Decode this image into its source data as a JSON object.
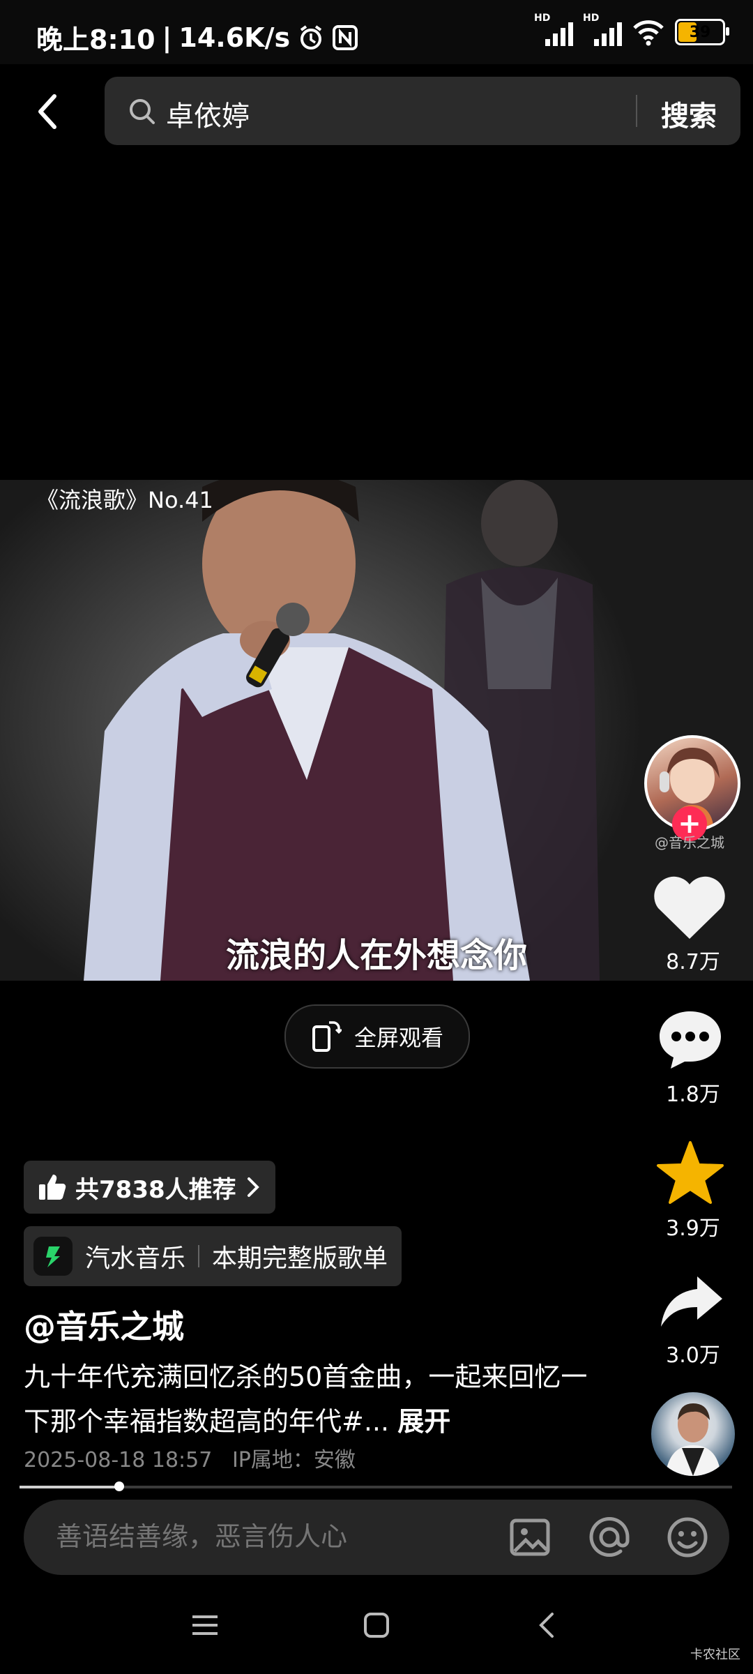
{
  "status_bar": {
    "time": "晚上8:10",
    "net_speed": "14.6K/s",
    "signal1_label": "HD",
    "signal2_label": "HD",
    "battery": "39",
    "battery_level": 0.39,
    "battery_color": "#f5b400"
  },
  "search": {
    "query": "卓依婷",
    "button": "搜索"
  },
  "video": {
    "title": "《流浪歌》No.41",
    "subtitle": "流浪的人在外想念你",
    "fullscreen_label": "全屏观看"
  },
  "right_rail": {
    "author_handle": "@音乐之城",
    "likes": "8.7万",
    "comments": "1.8万",
    "favorites": "3.9万",
    "shares": "3.0万",
    "like_color": "#f2f2f2",
    "favorite_color": "#f5b400"
  },
  "info": {
    "recommend": "共7838人推荐",
    "music_app": "汽水音乐",
    "music_link": "本期完整版歌单",
    "author": "@音乐之城",
    "caption": "九十年代充满回忆杀的50首金曲，一起来回忆一下那个幸福指数超高的年代#...",
    "expand": "展开",
    "timestamp": "2025-08-18 18:57",
    "ip": "IP属地：安徽"
  },
  "progress": {
    "fraction": 0.14
  },
  "comment": {
    "placeholder": "善语结善缘，恶言伤人心"
  },
  "watermark": "卡农社区"
}
